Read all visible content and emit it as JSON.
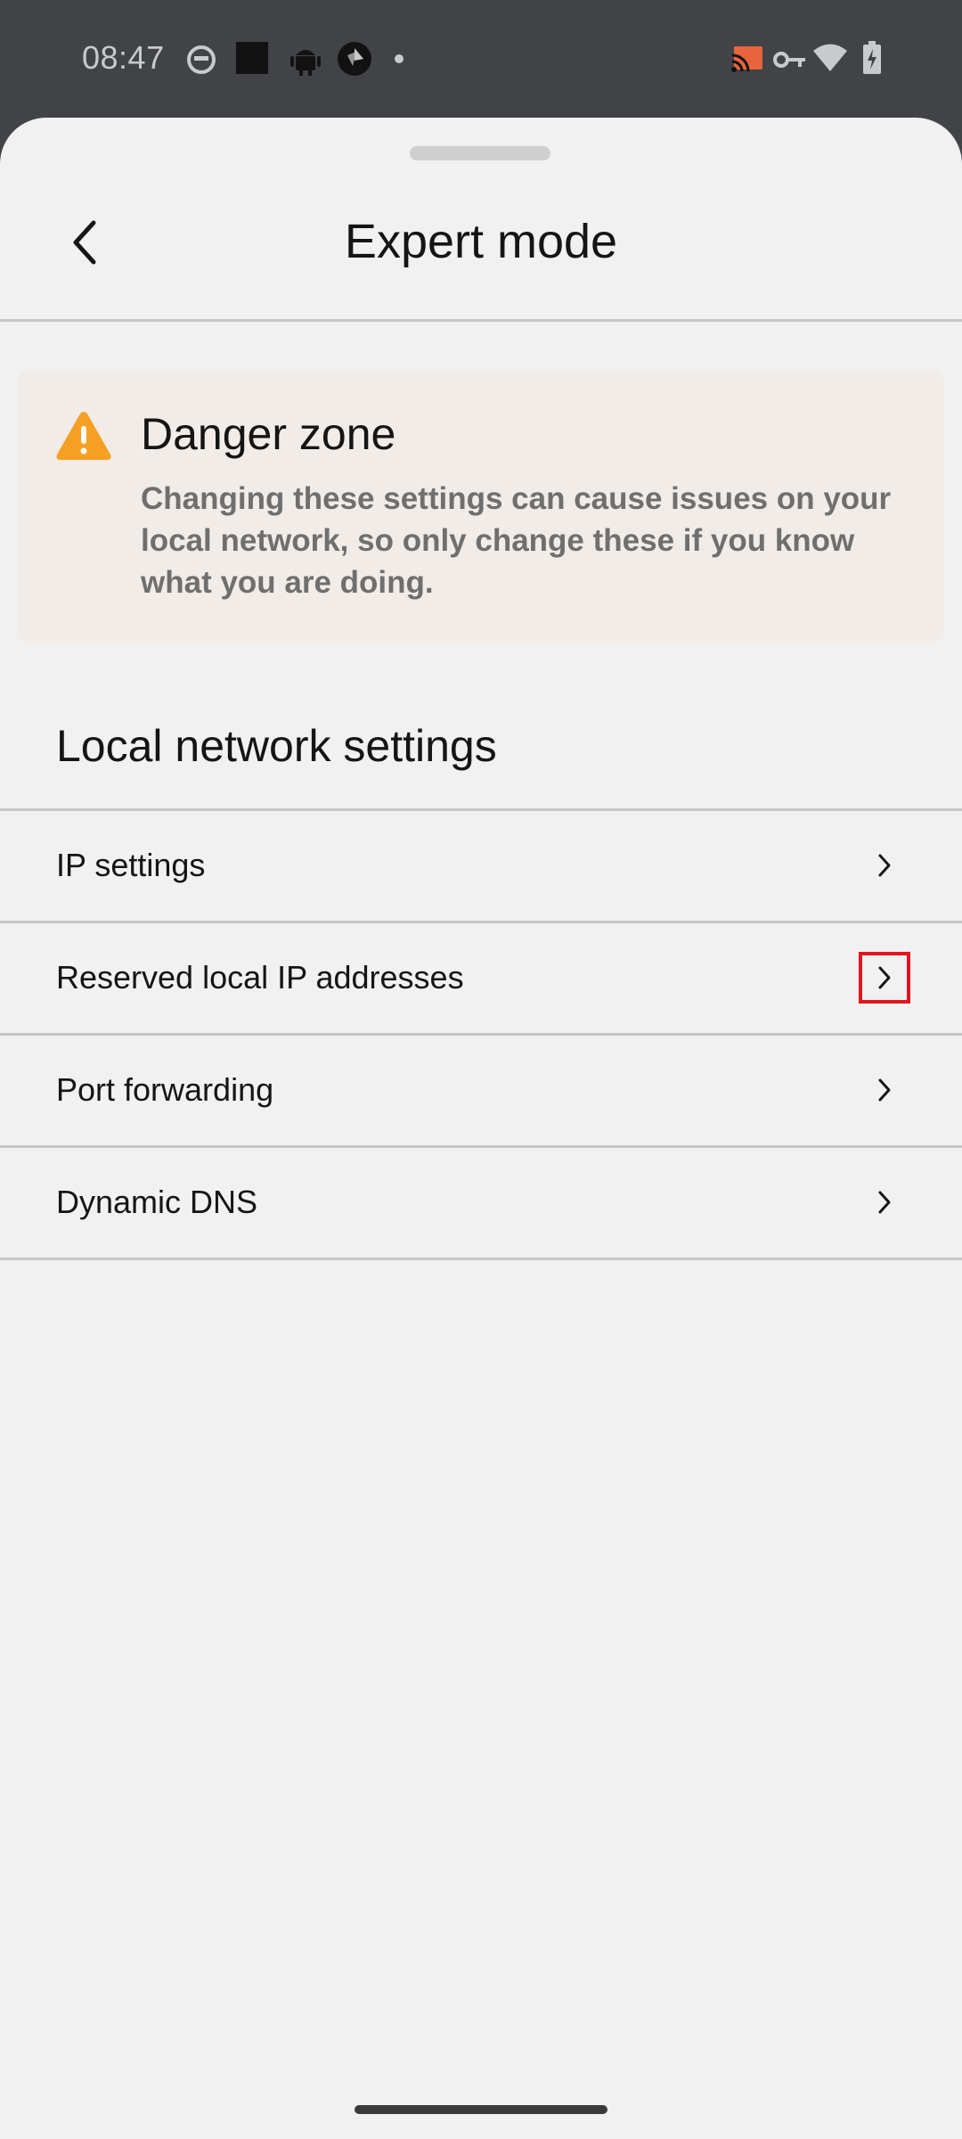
{
  "status_bar": {
    "time": "08:47",
    "left_icons": [
      "cat-icon",
      "square-app-icon",
      "android-icon",
      "shutter-app-icon",
      "dot-icon"
    ],
    "right_icons": [
      "cast-icon",
      "vpn-key-icon",
      "wifi-icon",
      "battery-charging-icon"
    ]
  },
  "header": {
    "title": "Expert mode",
    "back_icon": "chevron-left-icon"
  },
  "danger_card": {
    "icon": "warning-icon",
    "icon_color": "#f5a022",
    "title": "Danger zone",
    "text": "Changing these settings can cause issues on your local network, so only change these if you know what you are doing."
  },
  "section": {
    "heading": "Local network settings"
  },
  "items": [
    {
      "label": "IP settings"
    },
    {
      "label": "Reserved local IP addresses"
    },
    {
      "label": "Port forwarding"
    },
    {
      "label": "Dynamic DNS"
    }
  ],
  "colors": {
    "background": "#f1f1f1",
    "status_bar": "#414347",
    "card_background": "#f1ece7",
    "highlight": "#e3141b"
  }
}
